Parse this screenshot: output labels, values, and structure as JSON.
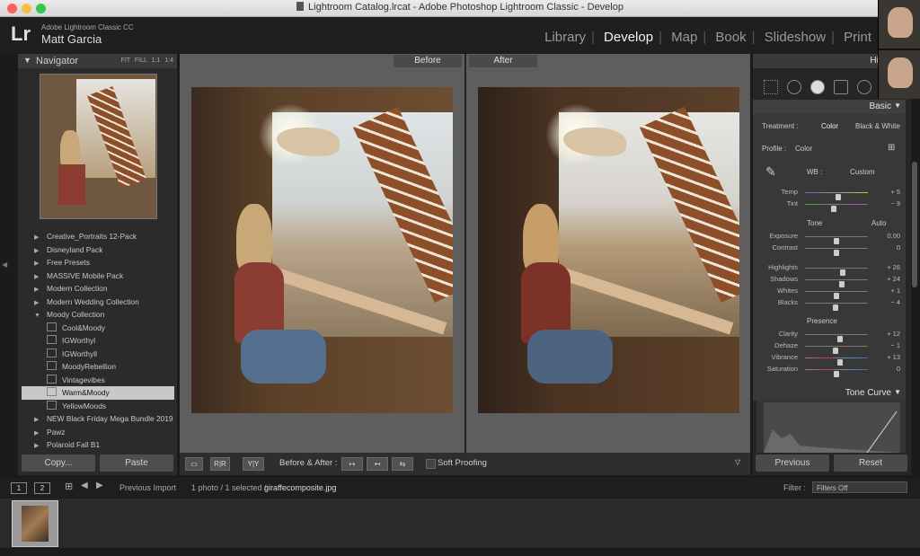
{
  "window": {
    "title": "Lightroom Catalog.lrcat - Adobe Photoshop Lightroom Classic - Develop"
  },
  "header": {
    "logo": "Lr",
    "product": "Adobe Lightroom Classic CC",
    "user": "Matt Garcia",
    "modules": [
      "Library",
      "Develop",
      "Map",
      "Book",
      "Slideshow",
      "Print"
    ],
    "active_module": "Develop"
  },
  "navigator": {
    "title": "Navigator",
    "zoom_options": [
      "FIT",
      "FILL",
      "1:1",
      "1:4"
    ]
  },
  "presets": [
    {
      "label": "Creative_Portraits 12-Pack",
      "type": "folder"
    },
    {
      "label": "Disneyland Pack",
      "type": "folder"
    },
    {
      "label": "Free Presets",
      "type": "folder"
    },
    {
      "label": "MASSIVE Mobile Pack",
      "type": "folder"
    },
    {
      "label": "Modern Collection",
      "type": "folder"
    },
    {
      "label": "Modern Wedding Collection",
      "type": "folder"
    },
    {
      "label": "Moody Collection",
      "type": "folder-open"
    },
    {
      "label": "Cool&Moody",
      "type": "preset"
    },
    {
      "label": "IGWorthyl",
      "type": "preset"
    },
    {
      "label": "IGWorthyll",
      "type": "preset"
    },
    {
      "label": "MoodyRebellion",
      "type": "preset"
    },
    {
      "label": "Vintagevibes",
      "type": "preset"
    },
    {
      "label": "Warm&Moody",
      "type": "preset",
      "selected": true
    },
    {
      "label": "YellowMoods",
      "type": "preset"
    },
    {
      "label": "NEW Black Friday Mega Bundle 2019",
      "type": "folder"
    },
    {
      "label": "Pawz",
      "type": "folder"
    },
    {
      "label": "Polaroid Fall B1",
      "type": "folder"
    }
  ],
  "left_buttons": {
    "copy": "Copy...",
    "paste": "Paste"
  },
  "view": {
    "before_label": "Before",
    "after_label": "After"
  },
  "toolbar": {
    "mode_label": "Before & After :",
    "soft_proofing": "Soft Proofing"
  },
  "right_panel": {
    "histogram_title": "Histogram",
    "basic_title": "Basic",
    "treatment_label": "Treatment :",
    "treatment_color": "Color",
    "treatment_bw": "Black & White",
    "profile_label": "Profile :",
    "profile_value": "Color",
    "wb_label": "WB :",
    "wb_value": "Custom",
    "tone_label": "Tone",
    "auto_label": "Auto",
    "presence_label": "Presence",
    "tone_curve_title": "Tone Curve",
    "sliders": {
      "temp": {
        "label": "Temp",
        "value": "+ 5",
        "position": 0.53
      },
      "tint": {
        "label": "Tint",
        "value": "− 9",
        "position": 0.46
      },
      "exposure": {
        "label": "Exposure",
        "value": "0.00",
        "position": 0.5
      },
      "contrast": {
        "label": "Contrast",
        "value": "0",
        "position": 0.5
      },
      "highlights": {
        "label": "Highlights",
        "value": "+ 26",
        "position": 0.6
      },
      "shadows": {
        "label": "Shadows",
        "value": "+ 24",
        "position": 0.58
      },
      "whites": {
        "label": "Whites",
        "value": "+ 1",
        "position": 0.5
      },
      "blacks": {
        "label": "Blacks",
        "value": "− 4",
        "position": 0.48
      },
      "clarity": {
        "label": "Clarity",
        "value": "+ 12",
        "position": 0.55
      },
      "dehaze": {
        "label": "Dehaze",
        "value": "− 1",
        "position": 0.49
      },
      "vibrance": {
        "label": "Vibrance",
        "value": "+ 13",
        "position": 0.56
      },
      "saturation": {
        "label": "Saturation",
        "value": "0",
        "position": 0.5
      }
    },
    "previous": "Previous",
    "reset": "Reset"
  },
  "filmstrip_bar": {
    "page1": "1",
    "page2": "2",
    "source": "Previous Import",
    "count": "1 photo / 1 selected /",
    "filename": "giraffecomposite.jpg",
    "filter_label": "Filter :",
    "filter_value": "Filters Off"
  }
}
